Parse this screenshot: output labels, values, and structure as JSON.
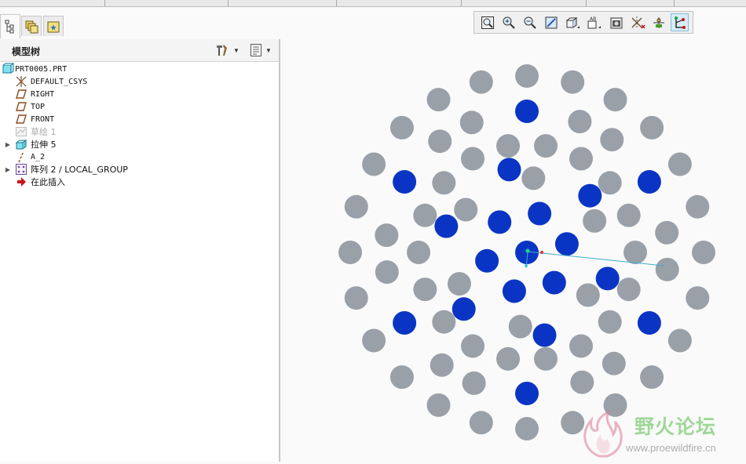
{
  "colors": {
    "hole_default": "#9aa0a8",
    "hole_selected": "#0a35c4",
    "axis_line": "#3ab0c8",
    "watermark_text": "#7cc870"
  },
  "nav_tabs": [
    {
      "icon": "model-tree-icon",
      "active": true
    },
    {
      "icon": "layers-icon",
      "active": false
    },
    {
      "icon": "favorites-icon",
      "active": false
    }
  ],
  "model_tree": {
    "title": "模型树",
    "settings_icon": "tree-settings-icon",
    "columns_icon": "show-columns-icon",
    "items": [
      {
        "label": "PRT0005.PRT",
        "icon": "part-icon",
        "expandable": false,
        "dimmed": false
      },
      {
        "label": "DEFAULT_CSYS",
        "icon": "csys-icon",
        "expandable": false,
        "dimmed": false
      },
      {
        "label": "RIGHT",
        "icon": "datum-plane-icon",
        "expandable": false,
        "dimmed": false
      },
      {
        "label": "TOP",
        "icon": "datum-plane-icon",
        "expandable": false,
        "dimmed": false
      },
      {
        "label": "FRONT",
        "icon": "datum-plane-icon",
        "expandable": false,
        "dimmed": false
      },
      {
        "label": "草绘 1",
        "icon": "sketch-icon",
        "expandable": false,
        "dimmed": true
      },
      {
        "label": "拉伸 5",
        "icon": "extrude-icon",
        "expandable": true,
        "dimmed": false
      },
      {
        "label": "A_2",
        "icon": "datum-axis-icon",
        "expandable": false,
        "dimmed": false
      },
      {
        "label": "阵列 2 / LOCAL_GROUP",
        "icon": "pattern-icon",
        "expandable": true,
        "dimmed": false
      },
      {
        "label": "在此插入",
        "icon": "insert-here-arrow-icon",
        "expandable": false,
        "dimmed": false
      }
    ]
  },
  "view_toolbar": [
    {
      "name": "refit-button",
      "icon": "refit-icon",
      "active": false
    },
    {
      "name": "zoom-in-button",
      "icon": "zoom-in-icon",
      "active": false
    },
    {
      "name": "zoom-out-button",
      "icon": "zoom-out-icon",
      "active": false
    },
    {
      "name": "repaint-button",
      "icon": "repaint-icon",
      "active": false
    },
    {
      "name": "display-style-button",
      "icon": "shaded-cube-icon",
      "active": false
    },
    {
      "name": "saved-orientations-button",
      "icon": "saved-views-icon",
      "active": false
    },
    {
      "name": "view-manager-button",
      "icon": "camera-icon",
      "active": false
    },
    {
      "name": "datum-display-button",
      "icon": "datum-display-icon",
      "active": false
    },
    {
      "name": "spin-center-button",
      "icon": "spin-center-icon",
      "active": false
    },
    {
      "name": "annotation-display-button",
      "icon": "annotation-icon",
      "active": true
    }
  ],
  "holes": {
    "center": [
      0,
      0
    ],
    "blue_rings": [
      {
        "radius": 52,
        "count": 6,
        "start_deg": -12
      },
      {
        "radius": 108,
        "count": 6,
        "start_deg": 18
      },
      {
        "radius": 180,
        "count": 6,
        "start_deg": 90
      }
    ]
  },
  "watermark": {
    "title": "野火论坛",
    "url": "www.proewildfire.cn"
  }
}
